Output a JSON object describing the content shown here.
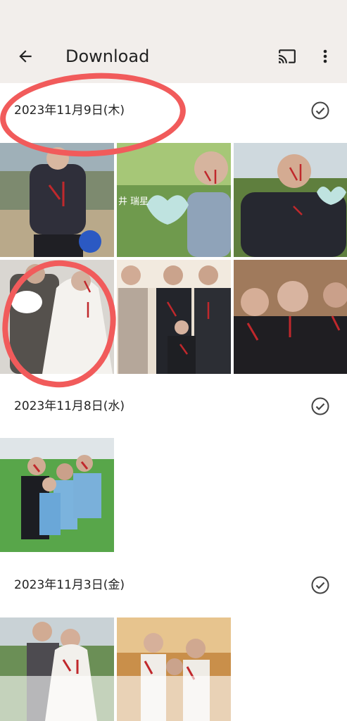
{
  "header": {
    "title": "Download",
    "back_icon": "arrow-back-icon",
    "cast_icon": "cast-icon",
    "more_icon": "more-vert-icon"
  },
  "sections": [
    {
      "date": "2023年11月9日(木)"
    },
    {
      "date": "2023年11月8日(水)"
    },
    {
      "date": "2023年11月3日(金)"
    }
  ],
  "photo_text": {
    "caption_1": "井 瑞星"
  },
  "colors": {
    "app_bar": "#f2eeeb",
    "annotation": "#f15b5b",
    "overlay_red": "#c0282c"
  }
}
